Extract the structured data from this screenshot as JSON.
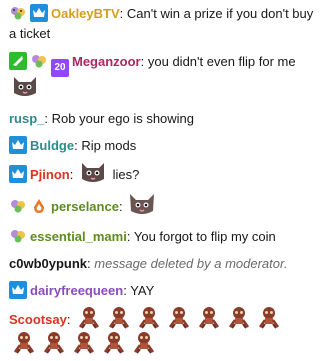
{
  "messages": [
    {
      "user": "OakleyBTV",
      "user_color": "#d4a017",
      "badges": [
        "pets-icon",
        "crown-icon"
      ],
      "text": "Can't win a prize if you don't buy a ticket"
    },
    {
      "user": "Meganzoor",
      "user_color": "#b0255f",
      "badges": [
        "partner-icon",
        "pets-icon",
        "sub-icon"
      ],
      "sub_badge_text": "20",
      "text": "you didn't even flip for me",
      "emote": "cat-emote"
    },
    {
      "user": "rusp_",
      "user_color": "#2e8b8b",
      "badges": [],
      "text": "Rob your ego is showing"
    },
    {
      "user": "Buldge",
      "user_color": "#2e8b8b",
      "badges": [
        "crown-icon"
      ],
      "text": "Rip mods"
    },
    {
      "user": "Pjinon",
      "user_color": "#e0311d",
      "badges": [
        "crown-icon"
      ],
      "text": "lies?",
      "emote": "cat-emote"
    },
    {
      "user": "perselance",
      "user_color": "#5d8c1f",
      "badges": [
        "pets-icon",
        "drop-icon"
      ],
      "text": "",
      "emote": "cat-emote"
    },
    {
      "user": "essential_mami",
      "user_color": "#5d8c1f",
      "badges": [
        "pets-icon"
      ],
      "text": "You forgot to flip my coin"
    },
    {
      "user": "c0wb0ypunk",
      "user_color": "#18181b",
      "badges": [],
      "text": "message deleted by a moderator."
    },
    {
      "user": "dairyfreequeen",
      "user_color": "#8a4bbf",
      "badges": [
        "crown-icon"
      ],
      "text": "YAY"
    },
    {
      "user": "Scootsay",
      "user_color": "#e0311d",
      "badges": [],
      "emote_repeat": 12,
      "emote": "skull-emote"
    }
  ],
  "separator": ":"
}
